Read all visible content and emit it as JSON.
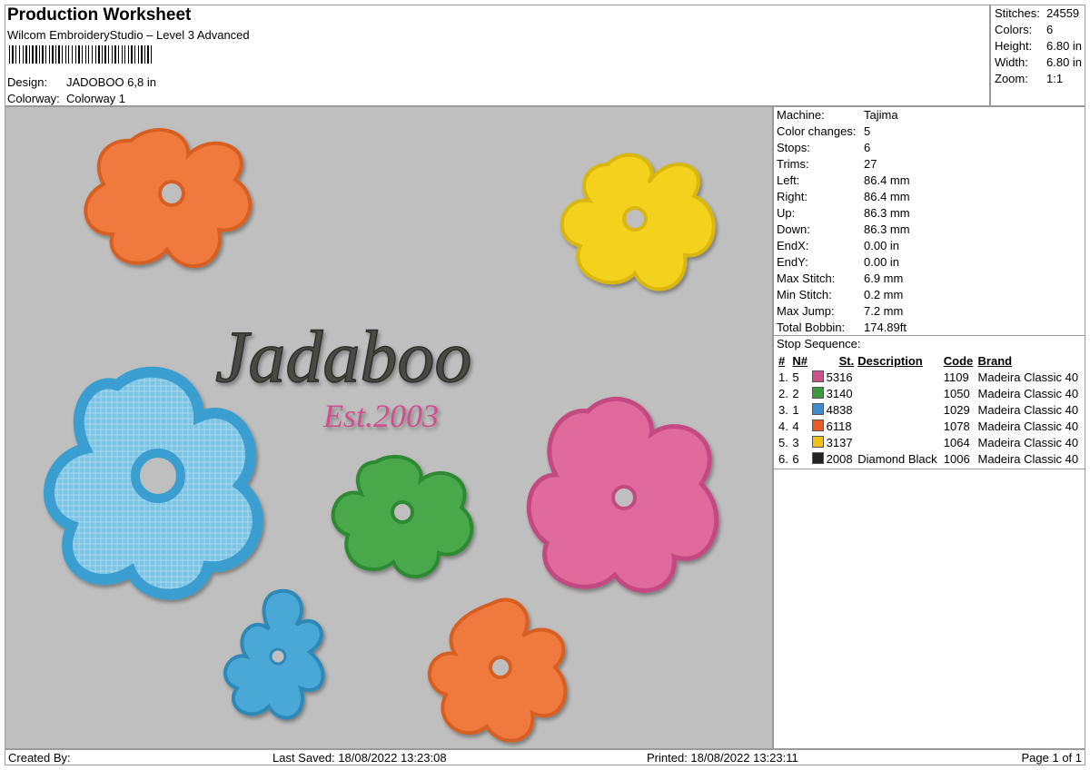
{
  "header": {
    "title": "Production Worksheet",
    "software": "Wilcom EmbroideryStudio – Level 3 Advanced",
    "design_label": "Design:",
    "design_value": "JADOBOO 6,8 in",
    "colorway_label": "Colorway:",
    "colorway_value": "Colorway 1"
  },
  "stats": [
    {
      "label": "Stitches:",
      "value": "24559"
    },
    {
      "label": "Colors:",
      "value": "6"
    },
    {
      "label": "Height:",
      "value": "6.80 in"
    },
    {
      "label": "Width:",
      "value": "6.80 in"
    },
    {
      "label": "Zoom:",
      "value": "1:1"
    }
  ],
  "machine_info": [
    {
      "label": "Machine:",
      "value": "Tajima"
    },
    {
      "label": "Color changes:",
      "value": "5"
    },
    {
      "label": "Stops:",
      "value": "6"
    },
    {
      "label": "Trims:",
      "value": "27"
    },
    {
      "label": "Left:",
      "value": "86.4 mm"
    },
    {
      "label": "Right:",
      "value": "86.4 mm"
    },
    {
      "label": "Up:",
      "value": "86.3 mm"
    },
    {
      "label": "Down:",
      "value": "86.3 mm"
    },
    {
      "label": "EndX:",
      "value": "0.00 in"
    },
    {
      "label": "EndY:",
      "value": "0.00 in"
    },
    {
      "label": "Max Stitch:",
      "value": "6.9 mm"
    },
    {
      "label": "Min Stitch:",
      "value": "0.2 mm"
    },
    {
      "label": "Max Jump:",
      "value": "7.2 mm"
    },
    {
      "label": "Total Bobbin:",
      "value": "174.89ft"
    }
  ],
  "stop_sequence": {
    "title": "Stop Sequence:",
    "headers": {
      "num": "#",
      "n": "N#",
      "st": "St.",
      "description": "Description",
      "code": "Code",
      "brand": "Brand"
    },
    "rows": [
      {
        "num": "1.",
        "n": "5",
        "color": "#d0508e",
        "st": "5316",
        "description": "",
        "code": "1109",
        "brand": "Madeira Classic 40"
      },
      {
        "num": "2.",
        "n": "2",
        "color": "#3a9a40",
        "st": "3140",
        "description": "",
        "code": "1050",
        "brand": "Madeira Classic 40"
      },
      {
        "num": "3.",
        "n": "1",
        "color": "#3a8ecf",
        "st": "4838",
        "description": "",
        "code": "1029",
        "brand": "Madeira Classic 40"
      },
      {
        "num": "4.",
        "n": "4",
        "color": "#ee5a24",
        "st": "6118",
        "description": "",
        "code": "1078",
        "brand": "Madeira Classic 40"
      },
      {
        "num": "5.",
        "n": "3",
        "color": "#f2c01a",
        "st": "3137",
        "description": "",
        "code": "1064",
        "brand": "Madeira Classic 40"
      },
      {
        "num": "6.",
        "n": "6",
        "color": "#222222",
        "st": "2008",
        "description": "Diamond Black",
        "code": "1006",
        "brand": "Madeira Classic 40"
      }
    ]
  },
  "design": {
    "main_text": "Jadaboo",
    "sub_text": "Est.2003",
    "colors": {
      "orange": "#f07a3c",
      "yellow": "#f2d21e",
      "blue": "#4aa8d6",
      "green": "#4aa84a",
      "pink": "#e06a9c",
      "text_dark": "#4a4a44",
      "text_pink": "#d0508e"
    }
  },
  "footer": {
    "created_by": "Created By:",
    "last_saved": "Last Saved: 18/08/2022 13:23:08",
    "printed": "Printed: 18/08/2022 13:23:11",
    "page": "Page 1 of 1"
  }
}
